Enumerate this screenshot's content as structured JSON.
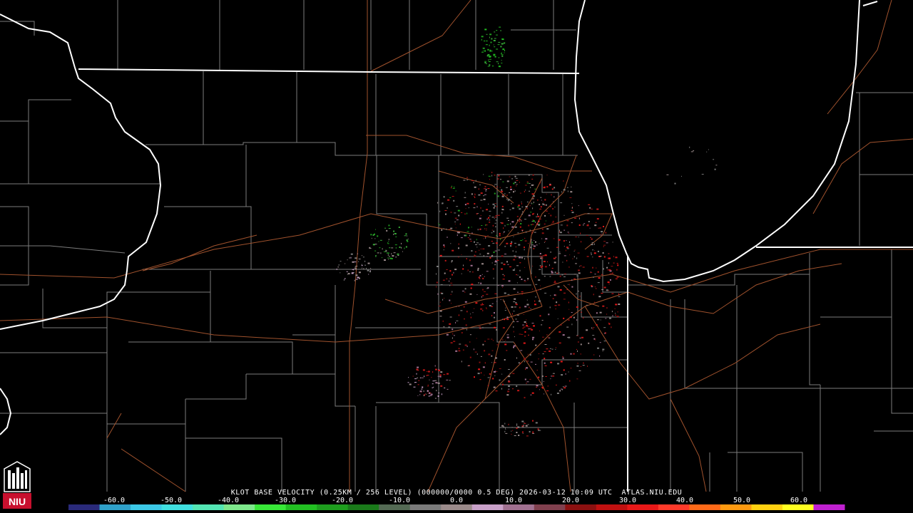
{
  "caption": "KLOT BASE VELOCITY (0.25KM / 256 LEVEL) (000000/0000 0.5 DEG) 2026-03-12 10:09 UTC  ATLAS.NIU.EDU",
  "scale": {
    "ticks": [
      {
        "label": "-60.0",
        "v": -60
      },
      {
        "label": "-50.0",
        "v": -50
      },
      {
        "label": "-40.0",
        "v": -40
      },
      {
        "label": "-30.0",
        "v": -30
      },
      {
        "label": "-20.0",
        "v": -20
      },
      {
        "label": "-10.0",
        "v": -10
      },
      {
        "label": "0.0",
        "v": 0
      },
      {
        "label": "10.0",
        "v": 10
      },
      {
        "label": "20.0",
        "v": 20
      },
      {
        "label": "30.0",
        "v": 30
      },
      {
        "label": "40.0",
        "v": 40
      },
      {
        "label": "50.0",
        "v": 50
      },
      {
        "label": "60.0",
        "v": 60
      }
    ],
    "colors": [
      "#2a2a7a",
      "#2fa0c8",
      "#3cc8e6",
      "#40e0e0",
      "#54e6b4",
      "#7ee88c",
      "#38e838",
      "#22c022",
      "#1e9e1e",
      "#1a7a1a",
      "#546a54",
      "#7a7a7a",
      "#9a8a8a",
      "#c8a0c8",
      "#a07090",
      "#80404e",
      "#8c1010",
      "#c01010",
      "#e81818",
      "#ff3a2a",
      "#ff6a18",
      "#ff9a10",
      "#ffd010",
      "#ffff20",
      "#c020d0"
    ]
  },
  "logo": {
    "text": "NIU",
    "color": "#c8102e"
  },
  "colors": {
    "state_border": "#ffffff",
    "county": "#8a8a8a",
    "road": "#a0522d",
    "background": "#000000"
  }
}
